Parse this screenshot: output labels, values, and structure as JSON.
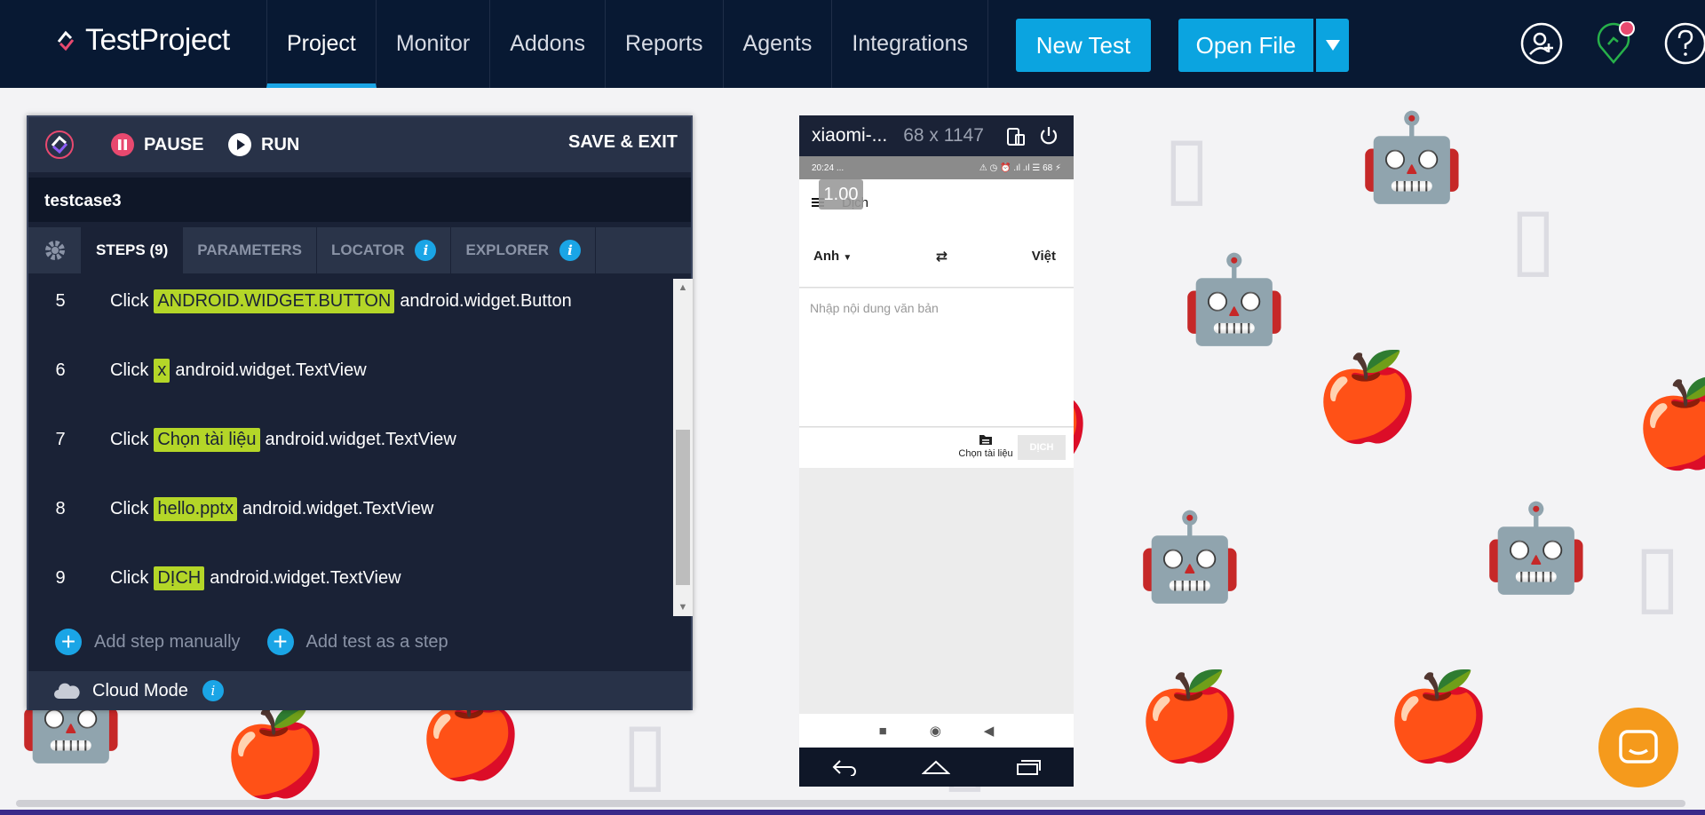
{
  "app": {
    "logo_text": "TestProject"
  },
  "nav": {
    "items": [
      {
        "label": "Project",
        "active": true
      },
      {
        "label": "Monitor",
        "active": false
      },
      {
        "label": "Addons",
        "active": false
      },
      {
        "label": "Reports",
        "active": false
      },
      {
        "label": "Agents",
        "active": false
      },
      {
        "label": "Integrations",
        "active": false
      }
    ]
  },
  "toolbar": {
    "new_test": "New Test",
    "open_file": "Open File",
    "dropdown_icon": "caret-down-icon"
  },
  "top_icons": [
    "user-icon",
    "agent-status-icon",
    "help-icon"
  ],
  "recorder": {
    "pause_label": "PAUSE",
    "run_label": "RUN",
    "save_exit_label": "SAVE & EXIT",
    "test_name": "testcase3",
    "tabs": [
      {
        "label": "STEPS (9)",
        "active": true
      },
      {
        "label": "PARAMETERS",
        "active": false
      },
      {
        "label": "LOCATOR",
        "active": false,
        "info": true
      },
      {
        "label": "EXPLORER",
        "active": false,
        "info": true
      }
    ],
    "steps": [
      {
        "num": "5",
        "action": "Click",
        "target": "ANDROID.WIDGET.BUTTON",
        "type": "android.widget.Button"
      },
      {
        "num": "6",
        "action": "Click",
        "target": "x",
        "type": "android.widget.TextView"
      },
      {
        "num": "7",
        "action": "Click",
        "target": "Chọn tài liệu",
        "type": "android.widget.TextView"
      },
      {
        "num": "8",
        "action": "Click",
        "target": "hello.pptx",
        "type": "android.widget.TextView"
      },
      {
        "num": "9",
        "action": "Click",
        "target": "DỊCH",
        "type": "android.widget.TextView"
      }
    ],
    "add_step_label": "Add step manually",
    "add_test_label": "Add test as a step",
    "cloud_mode_label": "Cloud Mode",
    "info_glyph": "i"
  },
  "device": {
    "name": "xiaomi-...",
    "resolution": "68 x 1147",
    "status_time": "20:24",
    "status_dots": "...",
    "status_right": "⚠ ◷ ⏰ .ıl .ıl ☰ 68 ⚡",
    "zoom_badge": "1.00",
    "app_title": "Dịch",
    "lang_from": "Anh",
    "lang_to": "Việt",
    "placeholder": "Nhập nội dung văn bản",
    "choose_doc": "Chọn tài liệu",
    "translate_btn": "DỊCH"
  },
  "colors": {
    "nav_bg": "#081933",
    "accent": "#0ba4e0",
    "highlight": "#b4d628",
    "chat": "#f59a1c"
  }
}
